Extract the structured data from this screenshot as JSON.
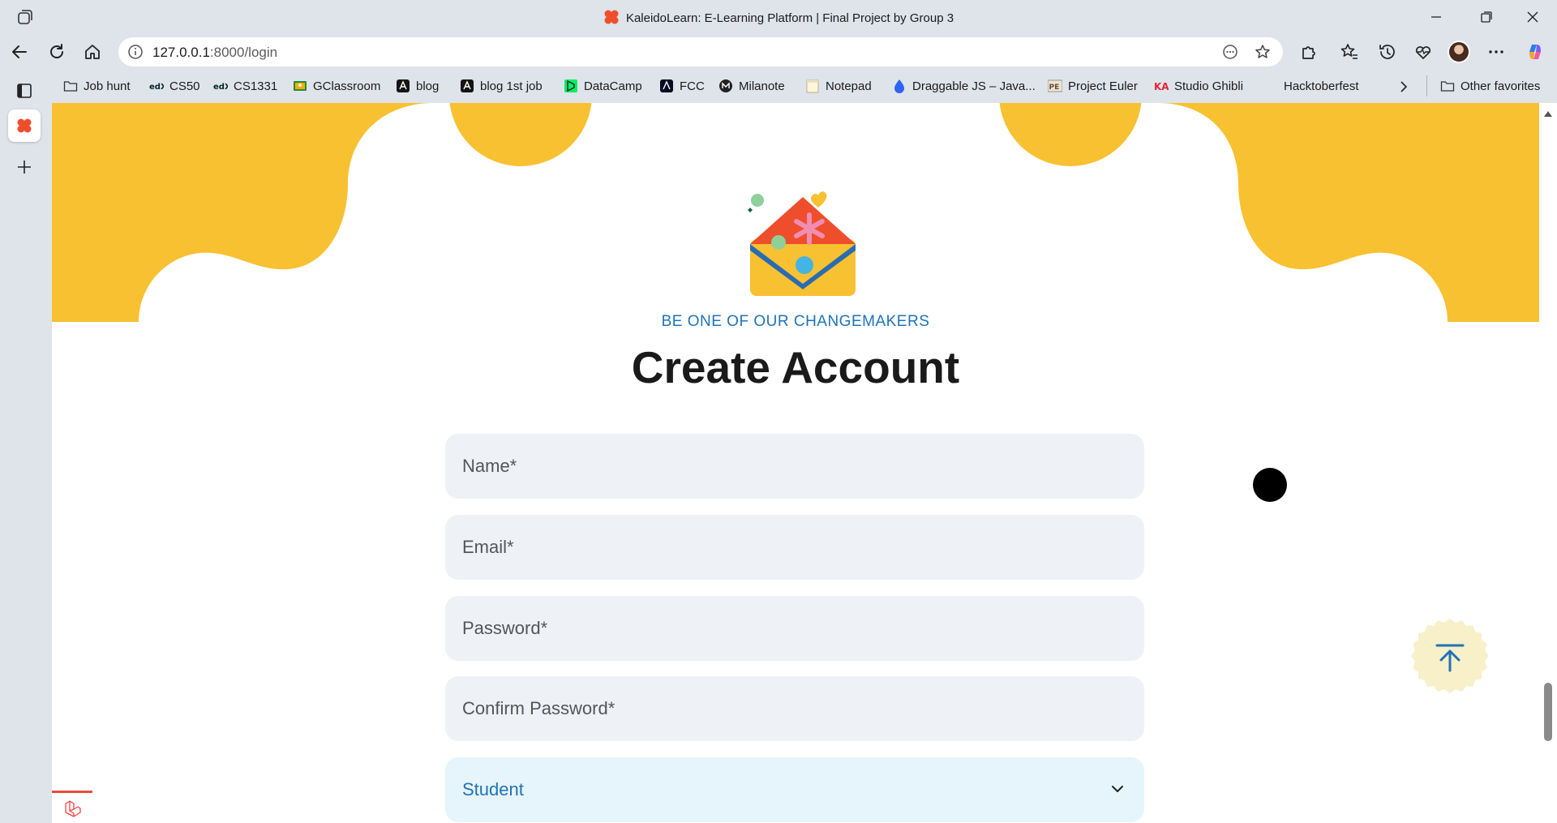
{
  "window": {
    "title": "KaleidoLearn: E-Learning Platform | Final Project by Group 3"
  },
  "browser": {
    "url_host": "127.0.0.1",
    "url_rest": ":8000/login"
  },
  "bookmarks": [
    {
      "label": "Job hunt",
      "icon": "folder-icon"
    },
    {
      "label": "CS50",
      "icon": "edx-icon"
    },
    {
      "label": "CS1331",
      "icon": "edx-icon"
    },
    {
      "label": "GClassroom",
      "icon": "google-classroom-icon"
    },
    {
      "label": "blog",
      "icon": "blog-icon"
    },
    {
      "label": "blog 1st job",
      "icon": "blog-icon"
    },
    {
      "label": "DataCamp",
      "icon": "datacamp-icon"
    },
    {
      "label": "FCC",
      "icon": "freecodecamp-icon"
    },
    {
      "label": "Milanote",
      "icon": "milanote-icon"
    },
    {
      "label": "Notepad",
      "icon": "notepad-icon"
    },
    {
      "label": "Draggable JS – Java...",
      "icon": "draggable-icon"
    },
    {
      "label": "Project Euler",
      "icon": "project-euler-icon"
    },
    {
      "label": "Studio Ghibli",
      "icon": "khan-academy-icon"
    },
    {
      "label": "Hacktoberfest",
      "icon": "hacktoberfest-icon"
    }
  ],
  "other_favorites": "Other favorites",
  "page": {
    "eyebrow": "BE ONE OF OUR CHANGEMAKERS",
    "headline": "Create Account",
    "fields": {
      "name_placeholder": "Name*",
      "email_placeholder": "Email*",
      "password_placeholder": "Password*",
      "confirm_placeholder": "Confirm Password*"
    },
    "role_select": "Student"
  },
  "colors": {
    "brand_yellow": "#f8c131",
    "brand_blue": "#1f73b7",
    "field_bg": "#eef1f6",
    "select_bg": "#e6f4fb"
  }
}
